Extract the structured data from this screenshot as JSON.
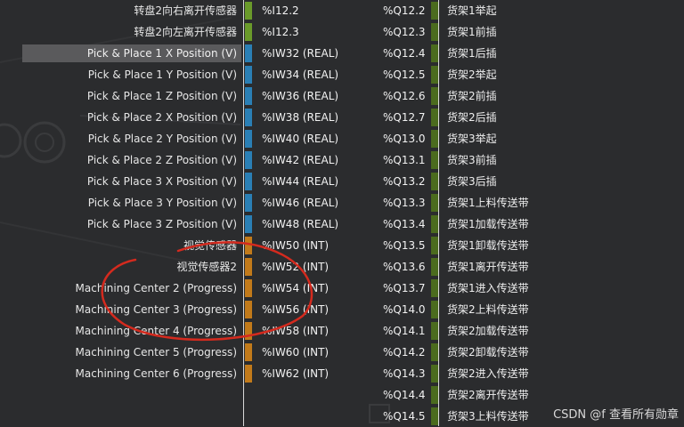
{
  "left_rows": [
    {
      "label": "转盘2向右离开传感器",
      "addr": "%I12.2",
      "color": "#6a9a2a"
    },
    {
      "label": "转盘2向左离开传感器",
      "addr": "%I12.3",
      "color": "#6a9a2a"
    },
    {
      "label": "Pick & Place 1 X Position (V)",
      "addr": "%IW32 (REAL)",
      "color": "#2a7fb5",
      "selected": true
    },
    {
      "label": "Pick & Place 1 Y Position (V)",
      "addr": "%IW34 (REAL)",
      "color": "#2a7fb5"
    },
    {
      "label": "Pick & Place 1 Z Position (V)",
      "addr": "%IW36 (REAL)",
      "color": "#2a7fb5"
    },
    {
      "label": "Pick & Place 2 X Position (V)",
      "addr": "%IW38 (REAL)",
      "color": "#2a7fb5"
    },
    {
      "label": "Pick & Place 2 Y Position (V)",
      "addr": "%IW40 (REAL)",
      "color": "#2a7fb5"
    },
    {
      "label": "Pick & Place 2 Z Position (V)",
      "addr": "%IW42 (REAL)",
      "color": "#2a7fb5"
    },
    {
      "label": "Pick & Place 3 X Position (V)",
      "addr": "%IW44 (REAL)",
      "color": "#2a7fb5"
    },
    {
      "label": "Pick & Place 3 Y Position (V)",
      "addr": "%IW46 (REAL)",
      "color": "#2a7fb5"
    },
    {
      "label": "Pick & Place 3 Z Position (V)",
      "addr": "%IW48 (REAL)",
      "color": "#2a7fb5"
    },
    {
      "label": "视觉传感器",
      "addr": "%IW50 (INT)",
      "color": "#c27a1a"
    },
    {
      "label": "视觉传感器2",
      "addr": "%IW52 (INT)",
      "color": "#c27a1a"
    },
    {
      "label": "Machining Center 2 (Progress)",
      "addr": "%IW54 (INT)",
      "color": "#c27a1a"
    },
    {
      "label": "Machining Center 3 (Progress)",
      "addr": "%IW56 (INT)",
      "color": "#c27a1a"
    },
    {
      "label": "Machining Center 4 (Progress)",
      "addr": "%IW58 (INT)",
      "color": "#c27a1a"
    },
    {
      "label": "Machining Center 5 (Progress)",
      "addr": "%IW60 (INT)",
      "color": "#c27a1a"
    },
    {
      "label": "Machining Center 6 (Progress)",
      "addr": "%IW62 (INT)",
      "color": "#c27a1a"
    }
  ],
  "right_rows": [
    {
      "addr": "%Q12.2",
      "label": "货架1举起"
    },
    {
      "addr": "%Q12.3",
      "label": "货架1前插"
    },
    {
      "addr": "%Q12.4",
      "label": "货架1后插"
    },
    {
      "addr": "%Q12.5",
      "label": "货架2举起"
    },
    {
      "addr": "%Q12.6",
      "label": "货架2前插"
    },
    {
      "addr": "%Q12.7",
      "label": "货架2后插"
    },
    {
      "addr": "%Q13.0",
      "label": "货架3举起"
    },
    {
      "addr": "%Q13.1",
      "label": "货架3前插"
    },
    {
      "addr": "%Q13.2",
      "label": "货架3后插"
    },
    {
      "addr": "%Q13.3",
      "label": "货架1上料传送带"
    },
    {
      "addr": "%Q13.4",
      "label": "货架1加载传送带"
    },
    {
      "addr": "%Q13.5",
      "label": "货架1卸载传送带"
    },
    {
      "addr": "%Q13.6",
      "label": "货架1离开传送带"
    },
    {
      "addr": "%Q13.7",
      "label": "货架1进入传送带"
    },
    {
      "addr": "%Q14.0",
      "label": "货架2上料传送带"
    },
    {
      "addr": "%Q14.1",
      "label": "货架2加载传送带"
    },
    {
      "addr": "%Q14.2",
      "label": "货架2卸载传送带"
    },
    {
      "addr": "%Q14.3",
      "label": "货架2进入传送带"
    },
    {
      "addr": "%Q14.4",
      "label": "货架2离开传送带"
    },
    {
      "addr": "%Q14.5",
      "label": "货架3上料传送带"
    }
  ],
  "watermark": "CSDN @f 查看所有勋章",
  "colors": {
    "background": "#2b2c2e",
    "digital": "#6a9a2a",
    "real": "#2a7fb5",
    "int": "#c27a1a",
    "output": "#4b6b1e",
    "annotation": "#d42a1e"
  }
}
